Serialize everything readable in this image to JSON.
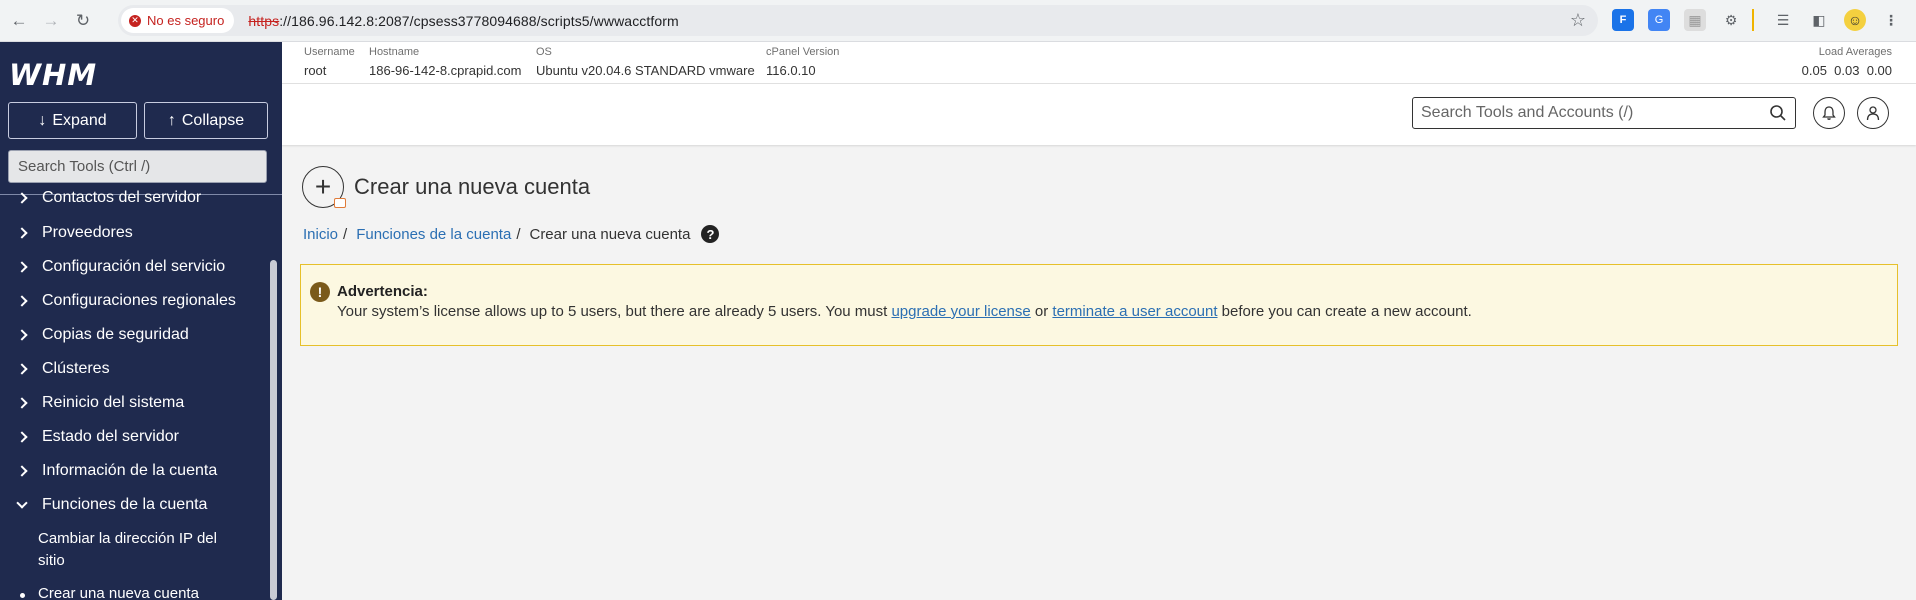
{
  "browser": {
    "security_label": "No es seguro",
    "url_scheme": "https",
    "url_rest": "://186.96.142.8:2087/cpsess3778094688/scripts5/wwwacctform"
  },
  "sidebar": {
    "logo": "WHM",
    "expand_label": "Expand",
    "collapse_label": "Collapse",
    "search_placeholder": "Search Tools (Ctrl /)",
    "items": [
      {
        "label": "Contactos del servidor"
      },
      {
        "label": "Proveedores"
      },
      {
        "label": "Configuración del servicio"
      },
      {
        "label": "Configuraciones regionales"
      },
      {
        "label": "Copias de seguridad"
      },
      {
        "label": "Clústeres"
      },
      {
        "label": "Reinicio del sistema"
      },
      {
        "label": "Estado del servidor"
      },
      {
        "label": "Información de la cuenta"
      },
      {
        "label": "Funciones de la cuenta"
      }
    ],
    "subitems": [
      {
        "label": "Cambiar la dirección IP del sitio"
      },
      {
        "label": "Crear una nueva cuenta"
      }
    ]
  },
  "infobar": {
    "username_label": "Username",
    "username": "root",
    "hostname_label": "Hostname",
    "hostname": "186-96-142-8.cprapid.com",
    "os_label": "OS",
    "os": "Ubuntu v20.04.6 STANDARD vmware",
    "cpanel_label": "cPanel Version",
    "cpanel": "116.0.10",
    "load_label": "Load Averages",
    "load": "0.05  0.03  0.00"
  },
  "header": {
    "search_placeholder": "Search Tools and Accounts (/)"
  },
  "main": {
    "title": "Crear una nueva cuenta",
    "breadcrumb": {
      "home": "Inicio",
      "section": "Funciones de la cuenta",
      "current": "Crear una nueva cuenta"
    },
    "warning": {
      "title": "Advertencia:",
      "text_before": "Your system’s license allows up to 5 users, but there are already 5 users. You must ",
      "link1": "upgrade your license",
      "text_mid": " or ",
      "link2": "terminate a user account",
      "text_after": " before you can create a new account."
    }
  },
  "colors": {
    "sidebar_bg": "#1f2a4e",
    "link": "#2b6fb3",
    "warning_bg": "#fcf8e1",
    "warning_border": "#e6c02a"
  }
}
